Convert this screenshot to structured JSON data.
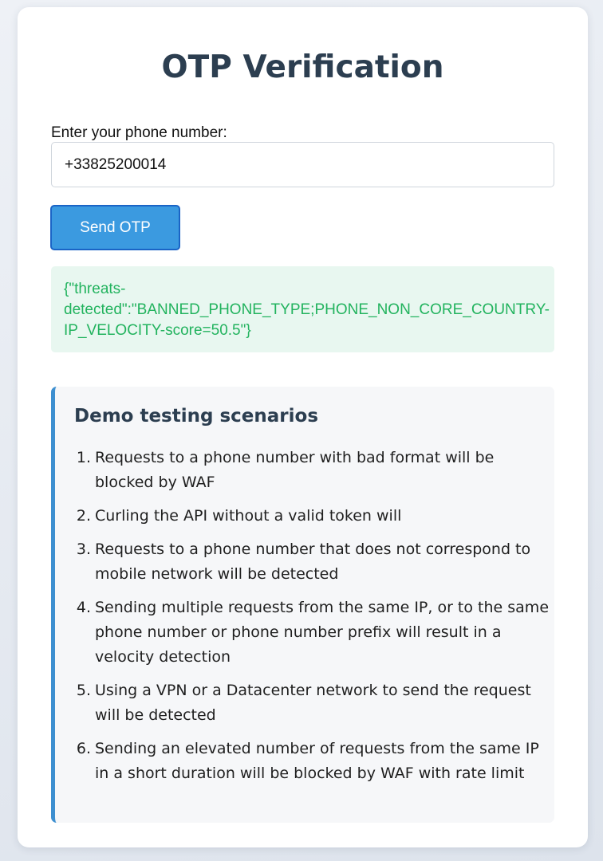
{
  "form": {
    "title": "OTP Verification",
    "phone_label": "Enter your phone number:",
    "phone_value": "+33825200014",
    "send_button_label": "Send OTP"
  },
  "result": {
    "text": "{\"threats-\ndetected\":\"BANNED_PHONE_TYPE;PHONE_NON_CORE_COUNTRY-\nIP_VELOCITY-score=50.5\"}"
  },
  "scenarios": {
    "title": "Demo testing scenarios",
    "items": [
      {
        "num": "1.",
        "text": "Requests to a phone number with bad format will be blocked by WAF"
      },
      {
        "num": "2.",
        "text": "Curling the API without a valid token will"
      },
      {
        "num": "3.",
        "text": "Requests to a phone number that does not correspond to mobile network will be detected"
      },
      {
        "num": "4.",
        "text": "Sending multiple requests from the same IP, or to the same phone number or phone number prefix will result in a velocity detection"
      },
      {
        "num": "5.",
        "text": "Using a VPN or a Datacenter network to send the request will be detected"
      },
      {
        "num": "6.",
        "text": "Sending an elevated number of requests from the same IP in a short duration will be blocked by WAF with rate limit"
      }
    ]
  },
  "colors": {
    "title_text": "#2c3e50",
    "button_bg": "#3b9ae0",
    "button_border": "#1a64c6",
    "result_bg": "#e8f7f0",
    "result_text": "#22b35e",
    "scenario_accent": "#3d8fd0"
  }
}
